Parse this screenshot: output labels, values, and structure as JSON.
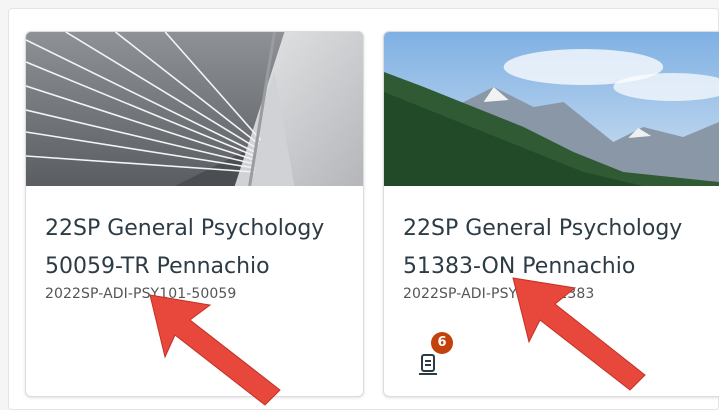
{
  "cards": [
    {
      "title_line1": "22SP General Psychology",
      "title_line2": "50059-TR Pennachio",
      "code": "2022SP-ADI-PSY101-50059",
      "image": "bridge-cables-image"
    },
    {
      "title_line1": "22SP General Psychology",
      "title_line2": "51383-ON Pennachio",
      "code": "2022SP-ADI-PSY101-51383",
      "image": "mountain-forest-image",
      "notification": {
        "icon": "assignments-icon",
        "count": "6",
        "badge_color": "#c2410c"
      }
    }
  ],
  "colors": {
    "arrow": "#e8473b",
    "title": "#2d3b45"
  }
}
